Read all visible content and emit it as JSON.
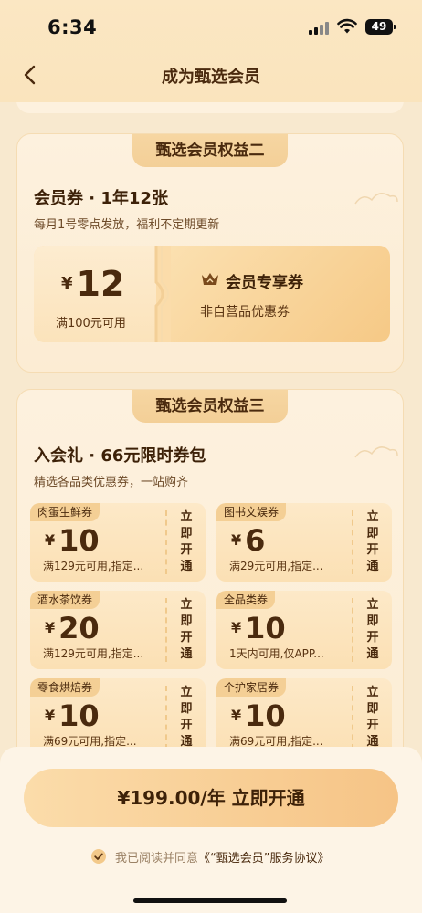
{
  "status_bar": {
    "time": "6:34",
    "battery": "49"
  },
  "nav": {
    "title": "成为甄选会员"
  },
  "benefit_two": {
    "title": "甄选会员权益二",
    "heading": "会员券 · 1年12张",
    "subtitle": "每月1号零点发放，福利不定期更新",
    "coupon": {
      "currency": "¥",
      "amount": "12",
      "condition": "满100元可用",
      "name": "会员专享券",
      "desc": "非自营品优惠券"
    }
  },
  "benefit_three": {
    "title": "甄选会员权益三",
    "heading": "入会礼 · 66元限时券包",
    "subtitle": "精选各品类优惠券，一站购齐",
    "coupons": [
      {
        "tag": "肉蛋生鲜券",
        "currency": "¥",
        "amount": "10",
        "condition": "满129元可用,指定...",
        "action": "立即开通"
      },
      {
        "tag": "图书文娱券",
        "currency": "¥",
        "amount": "6",
        "condition": "满29元可用,指定...",
        "action": "立即开通"
      },
      {
        "tag": "酒水茶饮券",
        "currency": "¥",
        "amount": "20",
        "condition": "满129元可用,指定...",
        "action": "立即开通"
      },
      {
        "tag": "全品类券",
        "currency": "¥",
        "amount": "10",
        "condition": "1天内可用,仅APP...",
        "action": "立即开通"
      },
      {
        "tag": "零食烘焙券",
        "currency": "¥",
        "amount": "10",
        "condition": "满69元可用,指定...",
        "action": "立即开通"
      },
      {
        "tag": "个护家居券",
        "currency": "¥",
        "amount": "10",
        "condition": "满69元可用,指定...",
        "action": "立即开通"
      }
    ]
  },
  "bottom": {
    "button": "¥199.00/年 立即开通",
    "agree_text": "我已阅读并同意",
    "agree_link": "《“甄选会员”服务协议》"
  },
  "colors": {
    "accent": "#f6c486",
    "text_dark": "#3d2108",
    "bg": "#f8e9cf"
  }
}
